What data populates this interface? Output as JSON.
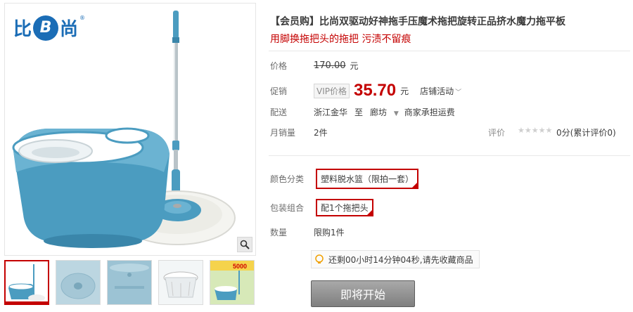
{
  "brand": {
    "logo_left": "比",
    "logo_mid": "B",
    "logo_right": "尚",
    "logo_reg": "®"
  },
  "product": {
    "title": "【会员购】比尚双驱动好神拖手压魔术拖把旋转正品挤水魔力拖平板",
    "subtitle": "用脚换拖把头的拖把 污渍不留痕"
  },
  "price": {
    "label": "价格",
    "original": "170.00",
    "unit": "元"
  },
  "promo": {
    "label": "促销",
    "tag": "VIP价格",
    "price": "35.70",
    "unit": "元",
    "activity": "店铺活动",
    "activity_caret": "﹀"
  },
  "shipping": {
    "label": "配送",
    "from": "浙江金华",
    "to_word": "至",
    "destination": "廊坊",
    "dest_caret": "▼",
    "fee": "商家承担运费"
  },
  "sales": {
    "label": "月销量",
    "count": "2",
    "unit": "件"
  },
  "rating": {
    "label": "评价",
    "stars": "★★★★★",
    "score": "0分(累计评价0)"
  },
  "color": {
    "label": "颜色分类",
    "selected": "塑料脱水篮（限拍一套）"
  },
  "package": {
    "label": "包装组合",
    "selected": "配1个拖把头"
  },
  "quantity": {
    "label": "数量",
    "limit": "限购1件"
  },
  "countdown": {
    "text": "还剩00小时14分钟04秒,请先收藏商品"
  },
  "actions": {
    "start": "即将开始"
  },
  "gallery": {
    "thumbs": [
      "thumb-1",
      "thumb-2",
      "thumb-3",
      "thumb-4",
      "thumb-5"
    ],
    "thumb5_badge": "5000"
  },
  "colors": {
    "accent": "#c40000",
    "brand": "#1b6db6",
    "bucket": "#4b9cc0"
  }
}
